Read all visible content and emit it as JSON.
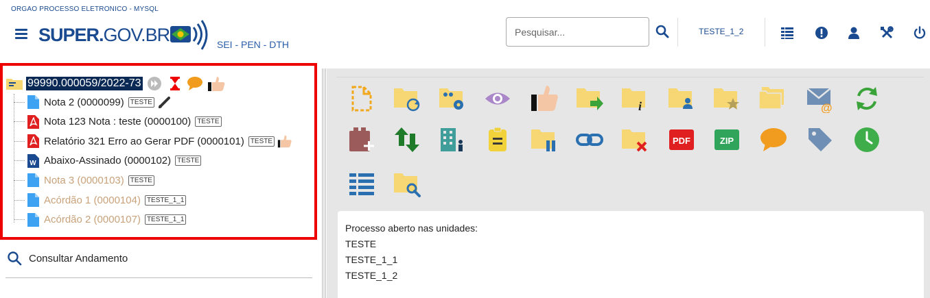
{
  "header": {
    "org_name": "ORGAO PROCESSO ELETRONICO - MYSQL",
    "logo_bold": "SUPER.",
    "logo_light": "GOV.BR",
    "system_tag": "SEI - PEN - DTH",
    "search_placeholder": "Pesquisar...",
    "unit": "TESTE_1_2",
    "icons": [
      "menu-icon",
      "search-icon",
      "list-icon",
      "alert-icon",
      "user-icon",
      "tools-icon",
      "power-icon"
    ]
  },
  "tree": {
    "root": {
      "label": "99990.000059/2022-73"
    },
    "items": [
      {
        "label": "Nota 2 (0000099)",
        "tag": "TESTE",
        "type": "doc",
        "muted": false,
        "extra": "pen-icon"
      },
      {
        "label": "Nota 123 Nota : teste (0000100)",
        "tag": "TESTE",
        "type": "pdf",
        "muted": false,
        "extra": ""
      },
      {
        "label": "Relatório 321 Erro ao Gerar PDF (0000101)",
        "tag": "TESTE",
        "type": "pdf",
        "muted": false,
        "extra": "thumb-icon"
      },
      {
        "label": "Abaixo-Assinado (0000102)",
        "tag": "TESTE",
        "type": "word",
        "muted": false,
        "extra": ""
      },
      {
        "label": "Nota 3 (0000103)",
        "tag": "TESTE",
        "type": "doc",
        "muted": true,
        "extra": ""
      },
      {
        "label": "Acórdão 1 (0000104)",
        "tag": "TESTE_1_1",
        "type": "doc",
        "muted": true,
        "extra": ""
      },
      {
        "label": "Acórdão 2 (0000107)",
        "tag": "TESTE_1_1",
        "type": "doc",
        "muted": true,
        "extra": ""
      }
    ]
  },
  "consult": {
    "label": "Consultar Andamento"
  },
  "toolbar": {
    "pdf_label": "PDF",
    "zip_label": "ZIP"
  },
  "info": {
    "title": "Processo aberto nas unidades:",
    "units": [
      "TESTE",
      "TESTE_1_1",
      "TESTE_1_2"
    ]
  },
  "colors": {
    "brand": "#1a4a8f",
    "highlight_border": "#e00000",
    "folder": "#f7d774",
    "panel_bg": "#e6e6e6"
  }
}
